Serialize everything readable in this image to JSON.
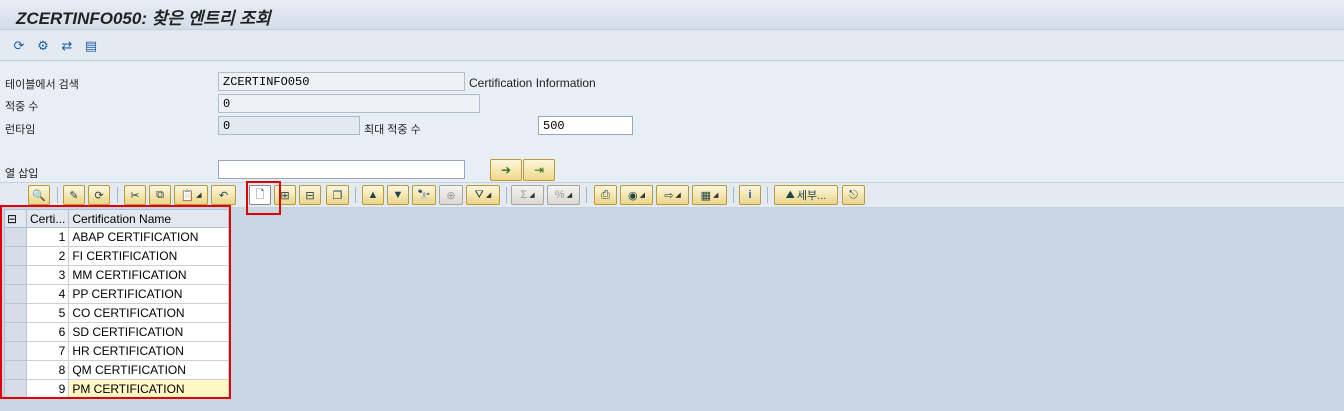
{
  "window": {
    "title": "ZCERTINFO050: 찾은 엔트리 조회"
  },
  "app_toolbar": {
    "icons": [
      "refresh-icon",
      "settings-icon",
      "check-table-icon",
      "list-icon"
    ],
    "glyphs": [
      "⟳",
      "⚙",
      "⇄",
      "▤"
    ]
  },
  "selection": {
    "table_label": "테이블에서 검색",
    "table_value": "ZCERTINFO050",
    "table_desc": "Certification Information",
    "hits_label": "적중 수",
    "hits_value": "0",
    "runtime_label": "런타임",
    "runtime_value": "0",
    "max_hits_label": "최대 적중 수",
    "max_hits_value": "500",
    "insert_col_label": "열 삽입",
    "insert_col_value": ""
  },
  "alv_toolbar": {
    "details_label": "세부..."
  },
  "grid": {
    "columns": [
      "Certi...",
      "Certification Name"
    ],
    "rows": [
      {
        "id": "1",
        "name": "ABAP CERTIFICATION"
      },
      {
        "id": "2",
        "name": "FI CERTIFICATION"
      },
      {
        "id": "3",
        "name": "MM CERTIFICATION"
      },
      {
        "id": "4",
        "name": "PP CERTIFICATION"
      },
      {
        "id": "5",
        "name": "CO CERTIFICATION"
      },
      {
        "id": "6",
        "name": "SD CERTIFICATION"
      },
      {
        "id": "7",
        "name": "HR CERTIFICATION"
      },
      {
        "id": "8",
        "name": "QM CERTIFICATION"
      },
      {
        "id": "9",
        "name": "PM CERTIFICATION"
      }
    ]
  },
  "colors": {
    "highlight_border": "#e00000",
    "button_gold": "#ecd68a",
    "background": "#c9d6e4"
  }
}
